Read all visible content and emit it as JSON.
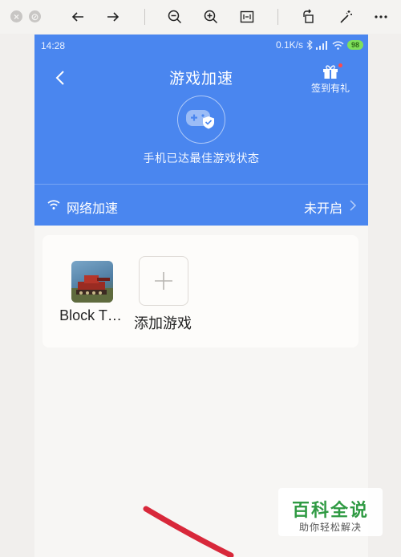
{
  "viewer_toolbar": {
    "icons": [
      "close-dot-icon",
      "minimize-dot-icon",
      "back-arrow-icon",
      "forward-arrow-icon",
      "zoom-out-icon",
      "zoom-in-icon",
      "fit-page-icon",
      "rotate-icon",
      "magic-wand-icon",
      "more-icon"
    ]
  },
  "status_bar": {
    "time": "14:28",
    "net_speed": "0.1K/s",
    "battery": "98"
  },
  "header": {
    "title": "游戏加速",
    "gift_label": "签到有礼",
    "status_text": "手机已达最佳游戏状态"
  },
  "network_row": {
    "label": "网络加速",
    "status": "未开启"
  },
  "games": {
    "items": [
      {
        "name": "Block T…"
      },
      {
        "name": "添加游戏"
      }
    ]
  },
  "watermark": {
    "title": "百科全说",
    "subtitle": "助你轻松解决"
  },
  "colors": {
    "header_blue": "#4a86ef",
    "watermark_green": "#2f9a43",
    "pen_red": "#d8283a"
  }
}
